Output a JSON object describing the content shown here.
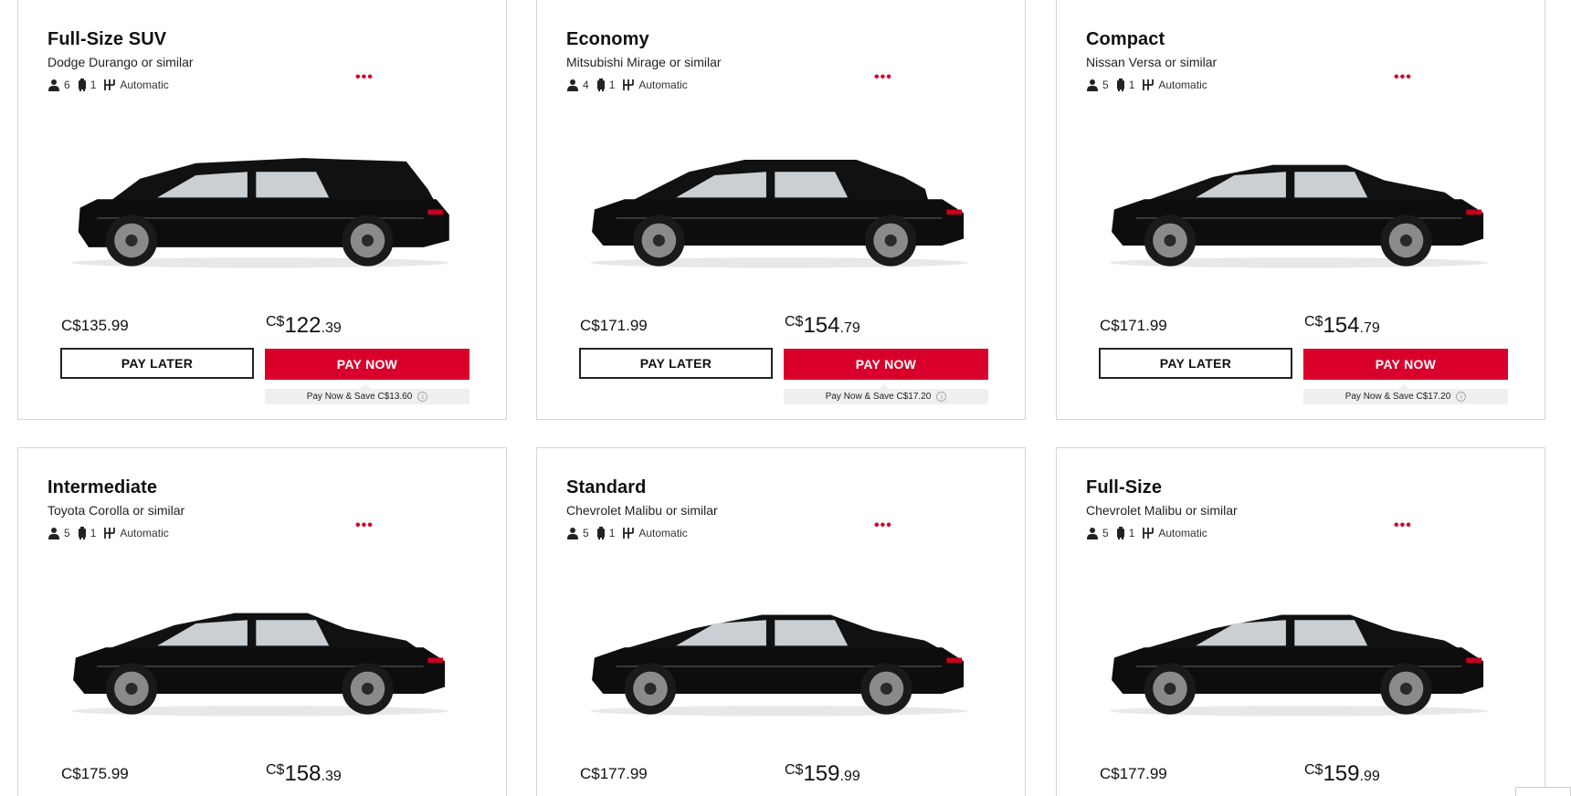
{
  "vehicles": [
    {
      "category": "Full-Size SUV",
      "model": "Dodge Durango or similar",
      "passengers": "6",
      "bags": "1",
      "transmission": "Automatic",
      "more_label": "•••",
      "car_shape": "suv",
      "pay_later_price": "C$135.99",
      "pay_now_currency": "C$",
      "pay_now_whole": "122",
      "pay_now_cents": ".39",
      "pay_later_label": "PAY LATER",
      "pay_now_label": "PAY NOW",
      "savings_note": "Pay Now & Save C$13.60"
    },
    {
      "category": "Economy",
      "model": "Mitsubishi Mirage or similar",
      "passengers": "4",
      "bags": "1",
      "transmission": "Automatic",
      "more_label": "•••",
      "car_shape": "hatchback",
      "pay_later_price": "C$171.99",
      "pay_now_currency": "C$",
      "pay_now_whole": "154",
      "pay_now_cents": ".79",
      "pay_later_label": "PAY LATER",
      "pay_now_label": "PAY NOW",
      "savings_note": "Pay Now & Save C$17.20"
    },
    {
      "category": "Compact",
      "model": "Nissan Versa or similar",
      "passengers": "5",
      "bags": "1",
      "transmission": "Automatic",
      "more_label": "•••",
      "car_shape": "sedan",
      "pay_later_price": "C$171.99",
      "pay_now_currency": "C$",
      "pay_now_whole": "154",
      "pay_now_cents": ".79",
      "pay_later_label": "PAY LATER",
      "pay_now_label": "PAY NOW",
      "savings_note": "Pay Now & Save C$17.20"
    },
    {
      "category": "Intermediate",
      "model": "Toyota Corolla or similar",
      "passengers": "5",
      "bags": "1",
      "transmission": "Automatic",
      "more_label": "•••",
      "car_shape": "sedan",
      "pay_later_price": "C$175.99",
      "pay_now_currency": "C$",
      "pay_now_whole": "158",
      "pay_now_cents": ".39"
    },
    {
      "category": "Standard",
      "model": "Chevrolet Malibu or similar",
      "passengers": "5",
      "bags": "1",
      "transmission": "Automatic",
      "more_label": "•••",
      "car_shape": "sedan-long",
      "pay_later_price": "C$177.99",
      "pay_now_currency": "C$",
      "pay_now_whole": "159",
      "pay_now_cents": ".99"
    },
    {
      "category": "Full-Size",
      "model": "Chevrolet Malibu or similar",
      "passengers": "5",
      "bags": "1",
      "transmission": "Automatic",
      "more_label": "•••",
      "car_shape": "sedan-long",
      "pay_later_price": "C$177.99",
      "pay_now_currency": "C$",
      "pay_now_whole": "159",
      "pay_now_cents": ".99"
    }
  ],
  "colors": {
    "accent": "#d8002b",
    "border": "#d6d6d6",
    "car_body": "#0d0d0d"
  },
  "icons": {
    "passengers": "person-icon",
    "bags": "luggage-icon",
    "transmission": "gearshift-icon",
    "info": "info-icon",
    "more": "more-options-icon"
  }
}
